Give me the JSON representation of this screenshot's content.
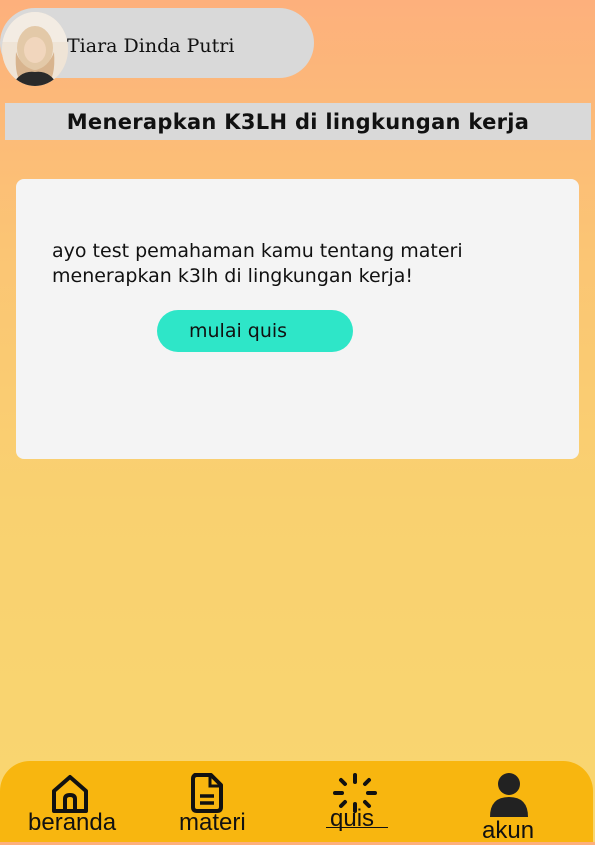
{
  "profile": {
    "name": "Tiara Dinda Putri",
    "avatar_icon": "avatar-photo"
  },
  "header": {
    "title": "Menerapkan K3LH di lingkungan kerja"
  },
  "card": {
    "text": "ayo test pemahaman kamu tentang materi menerapkan k3lh di lingkungan kerja!",
    "button_label": "mulai quis"
  },
  "bottom_nav": {
    "items": [
      {
        "label": "beranda",
        "icon": "home-icon"
      },
      {
        "label": "materi",
        "icon": "document-icon"
      },
      {
        "label": "quis",
        "icon": "loading-icon",
        "active": true
      },
      {
        "label": "akun",
        "icon": "user-icon"
      }
    ]
  },
  "colors": {
    "accent_button": "#2ee6c8",
    "nav_background": "#f8b60f",
    "panel": "#d9d9d9"
  }
}
